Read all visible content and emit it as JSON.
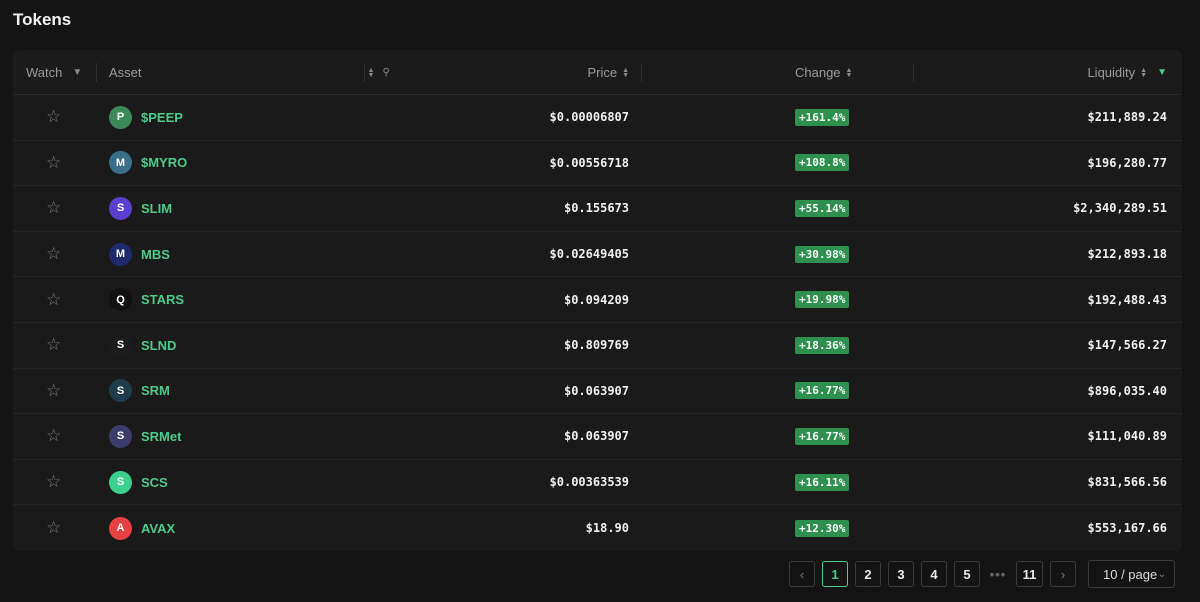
{
  "page": {
    "title": "Tokens"
  },
  "table": {
    "headers": {
      "watch": "Watch",
      "asset": "Asset",
      "price": "Price",
      "change": "Change",
      "liquidity": "Liquidity"
    },
    "rows": [
      {
        "symbol": "$PEEP",
        "logo_color": "#3c8a5a",
        "logo_glyph": "P",
        "price": "$0.00006807",
        "change": "+161.4%",
        "liquidity": "$211,889.24"
      },
      {
        "symbol": "$MYRO",
        "logo_color": "#3a6f8a",
        "logo_glyph": "M",
        "price": "$0.00556718",
        "change": "+108.8%",
        "liquidity": "$196,280.77"
      },
      {
        "symbol": "SLIM",
        "logo_color": "#5b3fd1",
        "logo_glyph": "S",
        "price": "$0.155673",
        "change": "+55.14%",
        "liquidity": "$2,340,289.51"
      },
      {
        "symbol": "MBS",
        "logo_color": "#1e2a6e",
        "logo_glyph": "M",
        "price": "$0.02649405",
        "change": "+30.98%",
        "liquidity": "$212,893.18"
      },
      {
        "symbol": "STARS",
        "logo_color": "#111111",
        "logo_glyph": "Q",
        "price": "$0.094209",
        "change": "+19.98%",
        "liquidity": "$192,488.43"
      },
      {
        "symbol": "SLND",
        "logo_color": "#1c1c1c",
        "logo_glyph": "S",
        "price": "$0.809769",
        "change": "+18.36%",
        "liquidity": "$147,566.27"
      },
      {
        "symbol": "SRM",
        "logo_color": "#1f3c4a",
        "logo_glyph": "S",
        "price": "$0.063907",
        "change": "+16.77%",
        "liquidity": "$896,035.40"
      },
      {
        "symbol": "SRMet",
        "logo_color": "#3c3c6a",
        "logo_glyph": "S",
        "price": "$0.063907",
        "change": "+16.77%",
        "liquidity": "$111,040.89"
      },
      {
        "symbol": "SCS",
        "logo_color": "#3ecf8e",
        "logo_glyph": "S",
        "price": "$0.00363539",
        "change": "+16.11%",
        "liquidity": "$831,566.56"
      },
      {
        "symbol": "AVAX",
        "logo_color": "#e84142",
        "logo_glyph": "A",
        "price": "$18.90",
        "change": "+12.30%",
        "liquidity": "$553,167.66"
      }
    ]
  },
  "pagination": {
    "prev": "‹",
    "next": "›",
    "pages": [
      "1",
      "2",
      "3",
      "4",
      "5"
    ],
    "ellipsis": "•••",
    "last": "11",
    "current": "1",
    "page_size": "10 / page"
  },
  "colors": {
    "accent": "#4ecb8a",
    "badge": "#2f8f4f",
    "background": "#141414"
  }
}
